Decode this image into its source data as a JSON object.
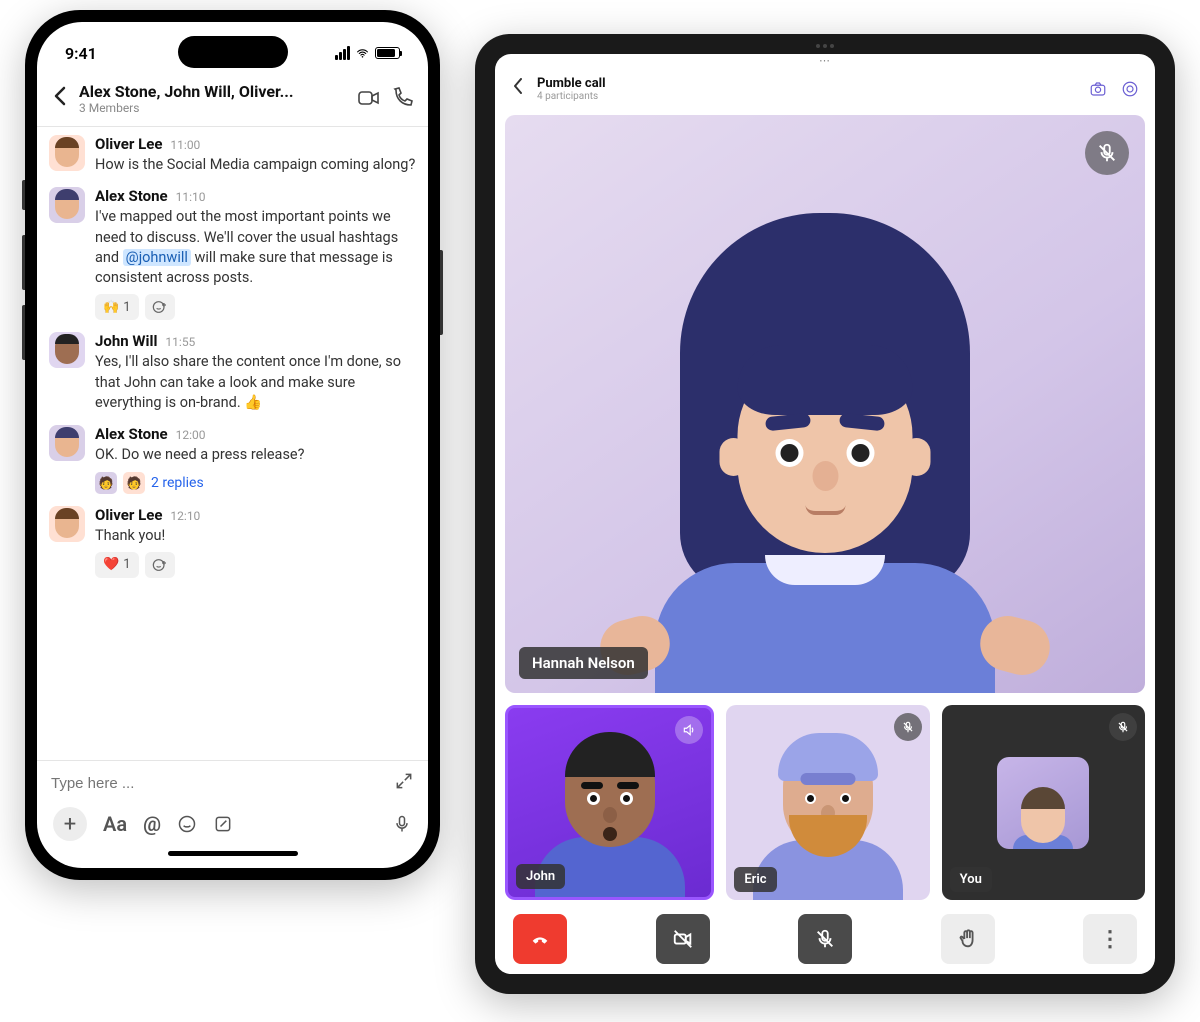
{
  "phone": {
    "status_time": "9:41",
    "header": {
      "title": "Alex Stone, John Will, Oliver...",
      "subtitle": "3 Members"
    },
    "messages": [
      {
        "author": "Oliver Lee",
        "time": "11:00",
        "text": "How is the Social Media campaign coming along?",
        "avatar": "oliver"
      },
      {
        "author": "Alex Stone",
        "time": "11:10",
        "text_before": "I've mapped out the most important points we need to discuss. We'll cover the usual hashtags and ",
        "mention": "@johnwill",
        "text_after": " will make sure that message is consistent across posts.",
        "avatar": "alex",
        "reaction_emoji": "🙌",
        "reaction_count": "1"
      },
      {
        "author": "John Will",
        "time": "11:55",
        "text": "Yes, I'll also share the content once I'm done, so that John can take a look and make sure everything is on-brand. 👍",
        "avatar": "john"
      },
      {
        "author": "Alex Stone",
        "time": "12:00",
        "text": "OK. Do we need a press release?",
        "avatar": "alex",
        "replies_text": "2 replies"
      },
      {
        "author": "Oliver Lee",
        "time": "12:10",
        "text": "Thank you!",
        "avatar": "oliver",
        "reaction_emoji": "❤️",
        "reaction_count": "1"
      }
    ],
    "composer": {
      "placeholder": "Type here ...",
      "format_label": "Aa",
      "mention_label": "@"
    }
  },
  "tablet": {
    "header": {
      "title": "Pumble call",
      "subtitle": "4 participants"
    },
    "main_speaker": "Hannah Nelson",
    "participants": {
      "p1": "John",
      "p2": "Eric",
      "p3": "You"
    }
  }
}
